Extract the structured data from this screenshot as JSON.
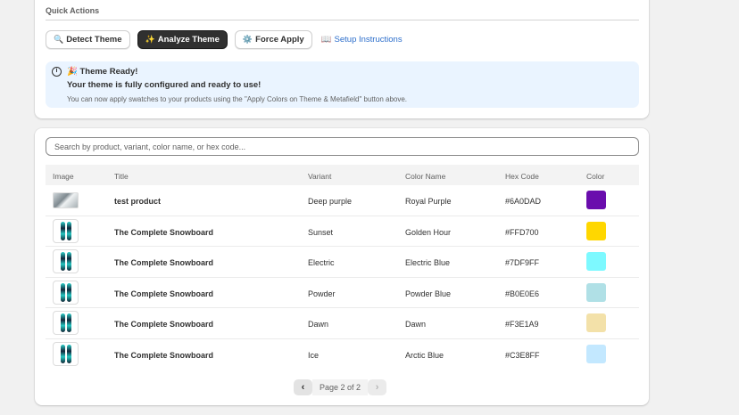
{
  "quick_actions": {
    "title": "Quick Actions",
    "buttons": [
      {
        "icon": "🔍",
        "label": "Detect Theme"
      },
      {
        "icon": "✨",
        "label": "Analyze Theme"
      },
      {
        "icon": "⚙️",
        "label": "Force Apply"
      }
    ],
    "link": {
      "icon": "📖",
      "label": "Setup Instructions"
    }
  },
  "banner": {
    "info_glyph": "i",
    "title": "🎉 Theme Ready!",
    "subtitle": "Your theme is fully configured and ready to use!",
    "note": "You can now apply swatches to your products using the \"Apply Colors on Theme & Metafield\" button above."
  },
  "search": {
    "placeholder": "Search by product, variant, color name, or hex code..."
  },
  "table": {
    "headers": {
      "image": "Image",
      "title": "Title",
      "variant": "Variant",
      "color_name": "Color Name",
      "hex_code": "Hex Code",
      "color": "Color"
    },
    "rows": [
      {
        "title": "test product",
        "variant": "Deep purple",
        "color_name": "Royal Purple",
        "hex": "#6A0DAD",
        "swatch": "#6A0DAD",
        "thumb": "photo"
      },
      {
        "title": "The Complete Snowboard",
        "variant": "Sunset",
        "color_name": "Golden Hour",
        "hex": "#FFD700",
        "swatch": "#FFD700",
        "thumb": "snowboard"
      },
      {
        "title": "The Complete Snowboard",
        "variant": "Electric",
        "color_name": "Electric Blue",
        "hex": "#7DF9FF",
        "swatch": "#7DF9FF",
        "thumb": "snowboard"
      },
      {
        "title": "The Complete Snowboard",
        "variant": "Powder",
        "color_name": "Powder Blue",
        "hex": "#B0E0E6",
        "swatch": "#B0E0E6",
        "thumb": "snowboard"
      },
      {
        "title": "The Complete Snowboard",
        "variant": "Dawn",
        "color_name": "Dawn",
        "hex": "#F3E1A9",
        "swatch": "#F3E1A9",
        "thumb": "snowboard"
      },
      {
        "title": "The Complete Snowboard",
        "variant": "Ice",
        "color_name": "Arctic Blue",
        "hex": "#C3E8FF",
        "swatch": "#C3E8FF",
        "thumb": "snowboard"
      }
    ]
  },
  "pagination": {
    "prev_glyph": "‹",
    "next_glyph": "›",
    "label": "Page 2 of 2"
  }
}
